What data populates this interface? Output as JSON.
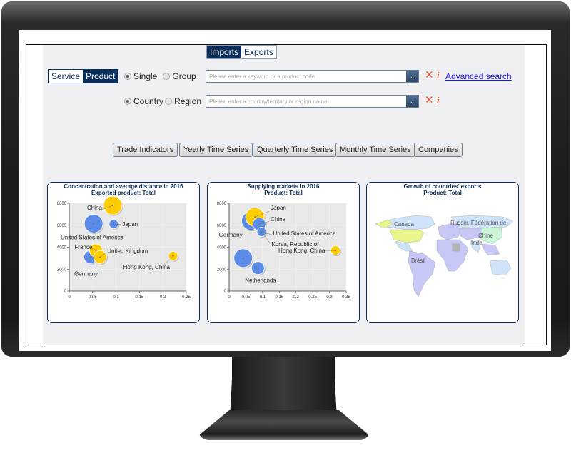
{
  "tabs": [
    {
      "label": "Imports",
      "active": true
    },
    {
      "label": "Exports",
      "active": false
    }
  ],
  "type_toggle": [
    {
      "label": "Service",
      "active": false
    },
    {
      "label": "Product",
      "active": true
    }
  ],
  "product_radios": [
    {
      "label": "Single",
      "checked": true
    },
    {
      "label": "Group",
      "checked": false
    }
  ],
  "country_radios": [
    {
      "label": "Country",
      "checked": true
    },
    {
      "label": "Region",
      "checked": false
    }
  ],
  "product_search": {
    "placeholder": "Please enter a keyword or a product code",
    "value": ""
  },
  "country_search": {
    "placeholder": "Please enter a country/territory or region name",
    "value": ""
  },
  "icons": {
    "clear": "✕",
    "info": "i",
    "dropdown": "⌄"
  },
  "advanced_search_label": "Advanced search",
  "nav_buttons": [
    {
      "label": "Trade Indicators"
    },
    {
      "label": "Yearly Time Series"
    },
    {
      "label": "Quarterly Time Series"
    },
    {
      "label": "Monthly Time Series"
    },
    {
      "label": "Companies"
    }
  ],
  "colors": {
    "brand": "#0b2d5b",
    "blue_bubble": "#5b8de8",
    "yellow_bubble": "#ffcc00",
    "accent_red": "#e4572e",
    "link": "#1a1aee"
  },
  "chart_data": [
    {
      "type": "scatter",
      "title": "Concentration and average distance in 2016",
      "subtitle": "Exported product: Total",
      "xlabel": "",
      "ylabel": "",
      "xlim": [
        0,
        0.25
      ],
      "ylim": [
        0,
        8000
      ],
      "xticks": [
        "0",
        "0.05",
        "0.1",
        "0.15",
        "0.2",
        "0.25"
      ],
      "yticks": [
        "0",
        "2000",
        "4000",
        "6000",
        "8000"
      ],
      "grid": true,
      "points": [
        {
          "label": "China",
          "x": 0.093,
          "y": 7800,
          "size": "large",
          "color": "yellow"
        },
        {
          "label": "United States of America",
          "x": 0.052,
          "y": 6150,
          "size": "large",
          "color": "blue"
        },
        {
          "label": "Japan",
          "x": 0.095,
          "y": 6100,
          "size": "small",
          "color": "blue"
        },
        {
          "label": "Germany",
          "x": 0.045,
          "y": 3100,
          "size": "medium",
          "color": "blue"
        },
        {
          "label": "France",
          "x": 0.057,
          "y": 3700,
          "size": "medium",
          "color": "yellow"
        },
        {
          "label": "United Kingdom",
          "x": 0.066,
          "y": 3100,
          "size": "medium",
          "color": "yellow"
        },
        {
          "label": "Hong Kong, China",
          "x": 0.222,
          "y": 3200,
          "size": "small",
          "color": "yellow"
        }
      ]
    },
    {
      "type": "scatter",
      "title": "Supplying markets in 2016",
      "subtitle": "Product: Total",
      "xlabel": "",
      "ylabel": "",
      "xlim": [
        0,
        0.35
      ],
      "ylim": [
        0,
        8000
      ],
      "xticks": [
        "0",
        "0.05",
        "0.1",
        "0.15",
        "0.2",
        "0.25",
        "0.3",
        "0.35"
      ],
      "yticks": [
        "0",
        "2000",
        "4000",
        "6000",
        "8000"
      ],
      "grid": true,
      "points": [
        {
          "label": "",
          "x": 0.065,
          "y": 6400,
          "size": "large",
          "color": "blue"
        },
        {
          "label": "Japan",
          "x": 0.077,
          "y": 6750,
          "size": "large",
          "color": "yellow"
        },
        {
          "label": "China",
          "x": 0.09,
          "y": 6100,
          "size": "medium",
          "color": "blue"
        },
        {
          "label": "United States of America",
          "x": 0.097,
          "y": 5400,
          "size": "small",
          "color": "blue"
        },
        {
          "label": "Korea, Republic of",
          "x": 0.097,
          "y": 5400,
          "size": "none",
          "color": "blue"
        },
        {
          "label": "Germany",
          "x": 0.042,
          "y": 3000,
          "size": "large",
          "color": "blue"
        },
        {
          "label": "Netherlands",
          "x": 0.086,
          "y": 2100,
          "size": "medium",
          "color": "blue"
        },
        {
          "label": "Hong Kong, China",
          "x": 0.318,
          "y": 3700,
          "size": "small",
          "color": "yellow"
        }
      ]
    },
    {
      "type": "map",
      "title": "Growth of countries' exports",
      "subtitle": "Product: Total",
      "labels": [
        "Canada",
        "Russie, Fédération de",
        "Chine",
        "Inde",
        "Brésil"
      ]
    }
  ]
}
